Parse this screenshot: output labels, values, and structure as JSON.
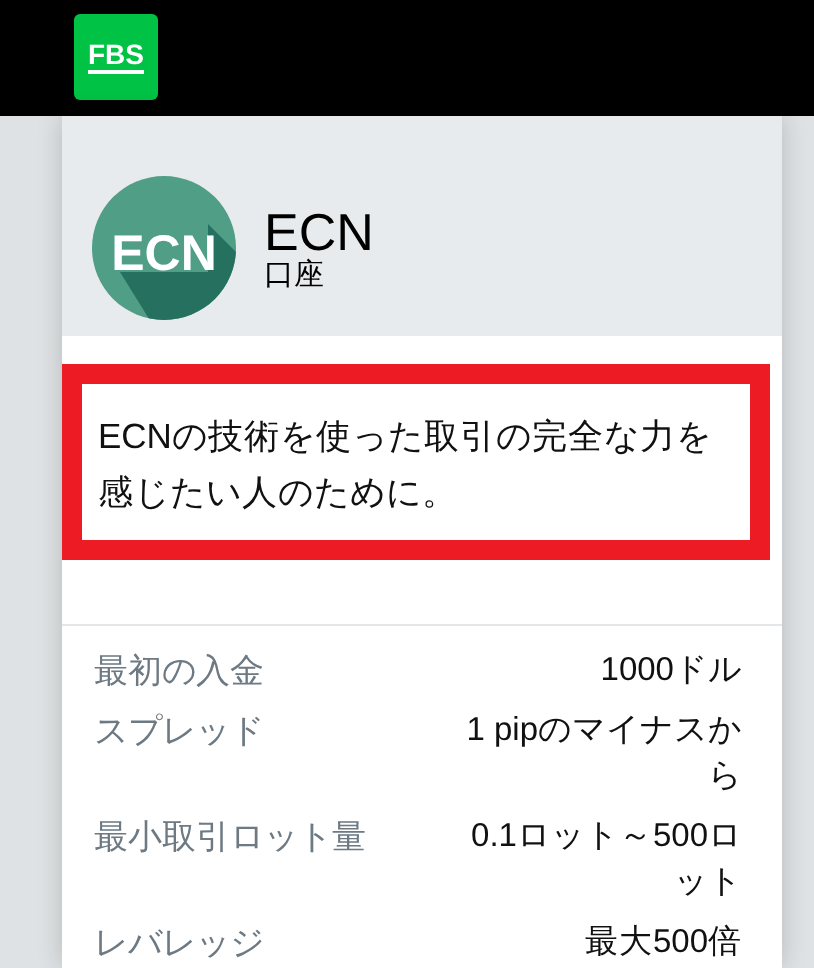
{
  "header": {
    "logo": "FBS"
  },
  "account": {
    "badge": "ECN",
    "title": "ECN",
    "subtitle": "口座"
  },
  "description": "ECNの技術を使った取引の完全な力を感じたい人のために。",
  "specs": [
    {
      "label": "最初の入金",
      "value": "1000ドル"
    },
    {
      "label": "スプレッド",
      "value": "1 pipのマイナスから"
    },
    {
      "label": "最小取引ロット量",
      "value": "0.1ロット～500ロット"
    },
    {
      "label": "レバレッジ",
      "value": "最大500倍"
    }
  ]
}
